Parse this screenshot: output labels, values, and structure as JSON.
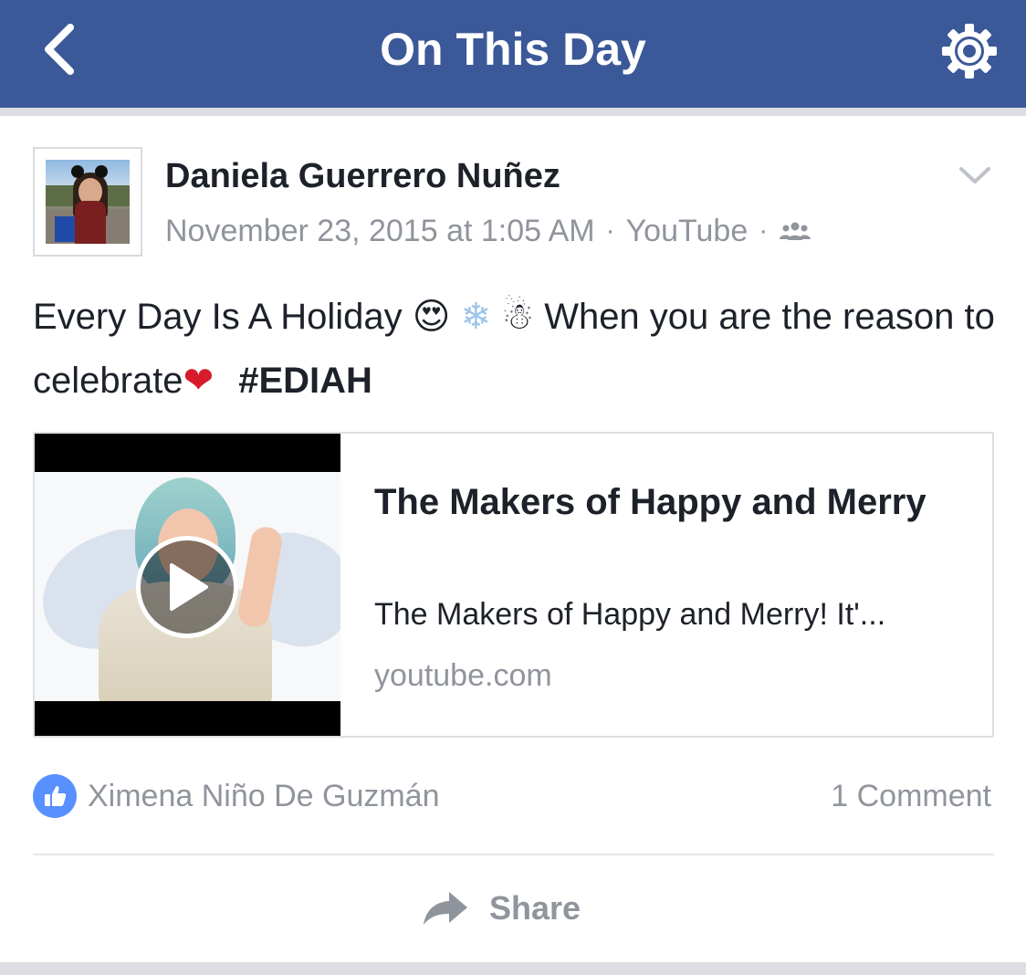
{
  "header": {
    "title": "On This Day",
    "back_icon": "chevron-left-icon",
    "settings_icon": "gear-icon",
    "background_color": "#3b5998"
  },
  "post": {
    "author": "Daniela Guerrero Nuñez",
    "timestamp": "November 23, 2015 at 1:05 AM",
    "separator": "·",
    "source": "YouTube",
    "privacy_icon": "friends-icon",
    "options_icon": "chevron-down-icon",
    "text_part1": "Every Day Is A Holiday",
    "emoji_heart_eyes": "😍",
    "emoji_snowflake": "❄",
    "emoji_snowman": "☃",
    "text_part2": "When you are the reason to celebrate",
    "emoji_heart": "❤",
    "hashtag": "#EDIAH"
  },
  "link_preview": {
    "title": "The Makers of Happy and Merry",
    "description": "The Makers of Happy and Merry! It'...",
    "domain": "youtube.com",
    "play_icon": "play-icon"
  },
  "reactions": {
    "like_icon": "thumbs-up-icon",
    "liked_by": "Ximena Niño De Guzmán",
    "comments": "1 Comment",
    "like_color": "#5890ff"
  },
  "actions": {
    "share_label": "Share",
    "share_icon": "share-arrow-icon"
  }
}
